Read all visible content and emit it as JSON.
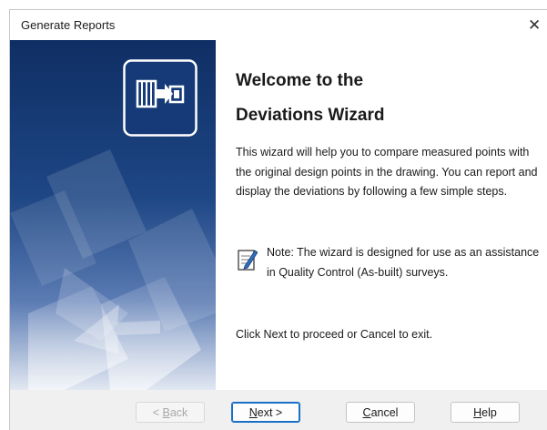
{
  "window": {
    "title": "Generate Reports",
    "close_glyph": "✕"
  },
  "banner": {
    "icon": "wizard-arrow-icon",
    "colors": {
      "deep": "#0f2e64",
      "mid": "#2a5aa8",
      "light": "#c5d2e6"
    }
  },
  "content": {
    "heading_line1": "Welcome to the",
    "heading_line2": "Deviations Wizard",
    "description": "This wizard will help you to compare measured points with the original design points in the drawing. You can report and display the deviations by following a few simple steps.",
    "note_icon": "note-pad-icon",
    "note": "Note: The wizard is designed for use as an assistance in Quality Control (As-built) surveys.",
    "proceed": "Click Next to proceed or Cancel to exit."
  },
  "buttons": {
    "back": {
      "prefix": "< ",
      "mnemonic": "B",
      "rest": "ack"
    },
    "next": {
      "mnemonic": "N",
      "rest": "ext >"
    },
    "cancel": {
      "mnemonic": "C",
      "rest": "ancel"
    },
    "help": {
      "mnemonic": "H",
      "rest": "elp"
    }
  }
}
